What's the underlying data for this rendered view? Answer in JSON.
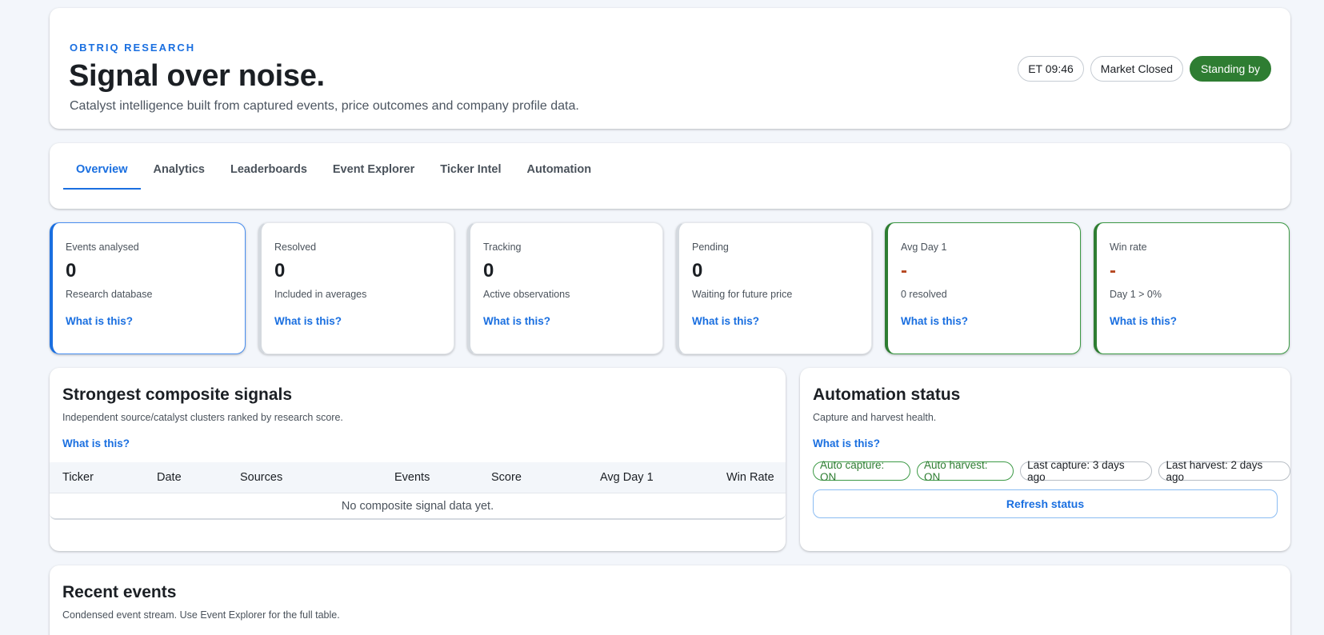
{
  "header": {
    "brand": "OBTRIQ RESEARCH",
    "title": "Signal over noise.",
    "subtitle": "Catalyst intelligence built from captured events, price outcomes and company profile data.",
    "clock": "ET 09:46",
    "market": "Market Closed",
    "status": "Standing by"
  },
  "tabs": [
    "Overview",
    "Analytics",
    "Leaderboards",
    "Event Explorer",
    "Ticker Intel",
    "Automation"
  ],
  "stats": [
    {
      "label": "Events analysed",
      "value": "0",
      "sub": "Research database",
      "link": "What is this?"
    },
    {
      "label": "Resolved",
      "value": "0",
      "sub": "Included in averages",
      "link": "What is this?"
    },
    {
      "label": "Tracking",
      "value": "0",
      "sub": "Active observations",
      "link": "What is this?"
    },
    {
      "label": "Pending",
      "value": "0",
      "sub": "Waiting for future price",
      "link": "What is this?"
    },
    {
      "label": "Avg Day 1",
      "value": "-",
      "sub": "0 resolved",
      "link": "What is this?"
    },
    {
      "label": "Win rate",
      "value": "-",
      "sub": "Day 1 > 0%",
      "link": "What is this?"
    }
  ],
  "signals": {
    "title": "Strongest composite signals",
    "subtitle": "Independent source/catalyst clusters ranked by research score.",
    "link": "What is this?",
    "columns": [
      "Ticker",
      "Date",
      "Sources",
      "Events",
      "Score",
      "Avg Day 1",
      "Win Rate"
    ],
    "empty": "No composite signal data yet."
  },
  "automation": {
    "title": "Automation status",
    "subtitle": "Capture and harvest health.",
    "link": "What is this?",
    "badges": [
      "Auto capture: ON",
      "Auto harvest: ON",
      "Last capture: 3 days ago",
      "Last harvest: 2 days ago"
    ],
    "refresh": "Refresh status"
  },
  "recent": {
    "title": "Recent events",
    "subtitle": "Condensed event stream. Use Event Explorer for the full table."
  },
  "colors": {
    "accent": "#1a6fe0",
    "positive": "#2e7d32",
    "negative": "#b5461f"
  }
}
